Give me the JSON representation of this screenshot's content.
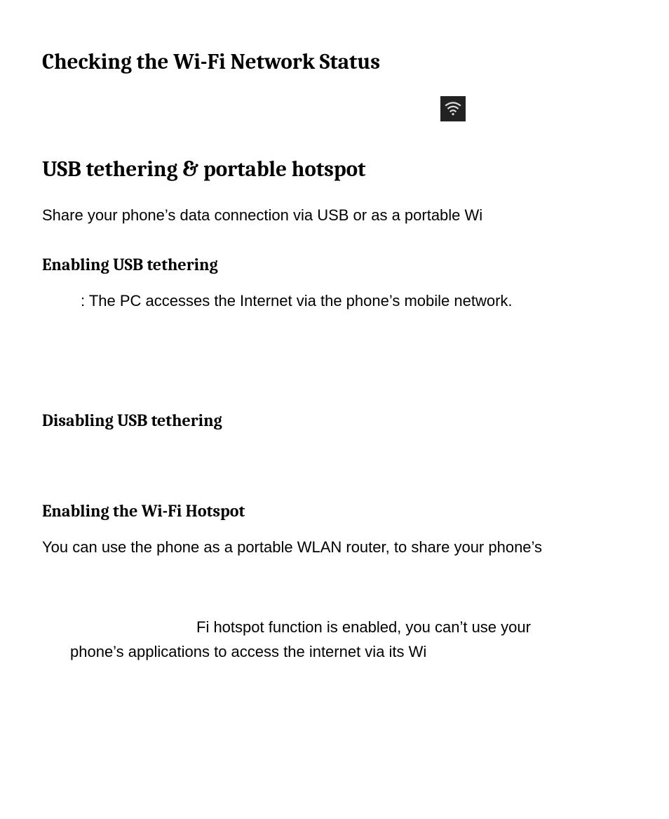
{
  "section1": {
    "title": "Checking the Wi-Fi Network Status"
  },
  "section2": {
    "title": "USB tethering & portable hotspot",
    "intro": "Share your phone’s data connection via USB or as a portable Wi"
  },
  "section3": {
    "title": "Enabling USB tethering",
    "body": ": The PC accesses the Internet via the phone’s mobile network."
  },
  "section4": {
    "title": "Disabling USB tethering"
  },
  "section5": {
    "title": "Enabling the Wi-Fi Hotspot",
    "body": "You can use the phone as a portable WLAN router, to share your phone’s"
  },
  "note": {
    "line1_right": "Fi hotspot function is enabled, you can’t use your",
    "line2": "phone’s applications to access the internet via its Wi"
  }
}
